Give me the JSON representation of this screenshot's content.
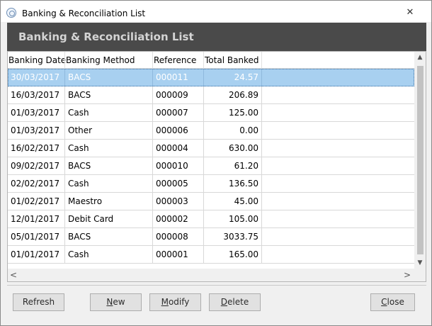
{
  "window": {
    "title": "Banking & Reconciliation List",
    "close_glyph": "✕"
  },
  "header": {
    "title": "Banking & Reconciliation List"
  },
  "grid": {
    "columns": [
      "Banking Date",
      "Banking Method",
      "Reference",
      "Total Banked"
    ],
    "rows": [
      {
        "date": "30/03/2017",
        "method": "BACS",
        "ref": "000011",
        "total": "24.57",
        "selected": true
      },
      {
        "date": "16/03/2017",
        "method": "BACS",
        "ref": "000009",
        "total": "206.89"
      },
      {
        "date": "01/03/2017",
        "method": "Cash",
        "ref": "000007",
        "total": "125.00"
      },
      {
        "date": "01/03/2017",
        "method": "Other",
        "ref": "000006",
        "total": "0.00"
      },
      {
        "date": "16/02/2017",
        "method": "Cash",
        "ref": "000004",
        "total": "630.00"
      },
      {
        "date": "09/02/2017",
        "method": "BACS",
        "ref": "000010",
        "total": "61.20"
      },
      {
        "date": "02/02/2017",
        "method": "Cash",
        "ref": "000005",
        "total": "136.50"
      },
      {
        "date": "01/02/2017",
        "method": "Maestro",
        "ref": "000003",
        "total": "45.00"
      },
      {
        "date": "12/01/2017",
        "method": "Debit Card",
        "ref": "000002",
        "total": "105.00"
      },
      {
        "date": "05/01/2017",
        "method": "BACS",
        "ref": "000008",
        "total": "3033.75"
      },
      {
        "date": "01/01/2017",
        "method": "Cash",
        "ref": "000001",
        "total": "165.00"
      }
    ]
  },
  "scrollbar": {
    "up_glyph": "▲",
    "down_glyph": "▼",
    "left_glyph": "<",
    "right_glyph": ">"
  },
  "buttons": {
    "refresh": "Refresh",
    "new_first": "N",
    "new_rest": "ew",
    "modify_first": "M",
    "modify_rest": "odify",
    "delete_first": "D",
    "delete_rest": "elete",
    "close_first": "C",
    "close_rest": "lose"
  },
  "colors": {
    "header_bg": "#4a4a4a",
    "selection": "#a8d0f0"
  }
}
